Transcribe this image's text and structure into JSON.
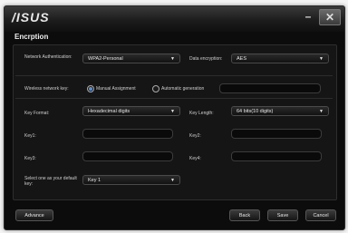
{
  "window": {
    "logo": "/ISUS",
    "minimize_glyph": "–",
    "close_glyph": "✕"
  },
  "section_title": "Encrption",
  "network_auth": {
    "label": "Network Authentication:",
    "value": "WPA2-Personal"
  },
  "data_encryption": {
    "label": "Data encryption:",
    "value": "AES"
  },
  "wireless_key": {
    "label": "Wireless network key:",
    "manual_label": "Manual Assignment",
    "auto_label": "Automatic generation",
    "selected": "manual",
    "value": ""
  },
  "key_format": {
    "label": "Key Format:",
    "value": "Hexadecimal digits"
  },
  "key_length": {
    "label": "Key Length:",
    "value": "64 bits(10 digits)"
  },
  "keys": [
    {
      "label": "Key1:",
      "value": ""
    },
    {
      "label": "Key2:",
      "value": ""
    },
    {
      "label": "Key3:",
      "value": ""
    },
    {
      "label": "Key4:",
      "value": ""
    }
  ],
  "default_key": {
    "label": "Select one as your default key:",
    "value": "Key 1"
  },
  "buttons": {
    "advance": "Advance",
    "back": "Back",
    "save": "Save",
    "cancel": "Cancel"
  },
  "colors": {
    "window_bg": "#0c0c0c",
    "radio_selected": "#5a8fd6",
    "text": "#cfcfcf"
  },
  "icons": {
    "caret": "caret-down-icon",
    "close": "close-icon",
    "minimize": "minimize-icon"
  }
}
